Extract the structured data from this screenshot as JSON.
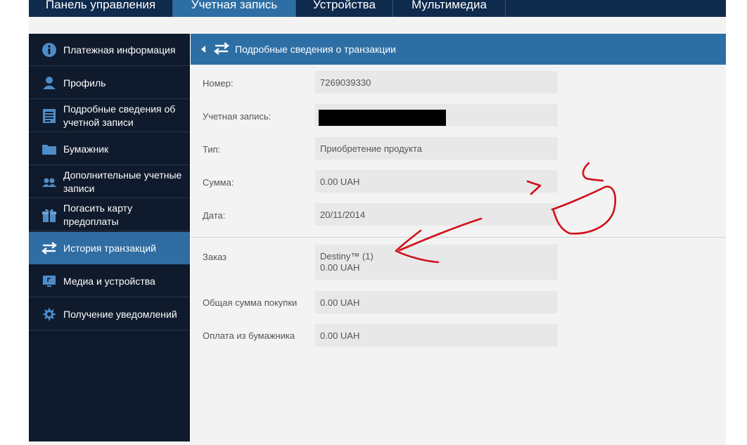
{
  "topnav": {
    "tabs": [
      {
        "label": "Панель управления"
      },
      {
        "label": "Учетная запись"
      },
      {
        "label": "Устройства"
      },
      {
        "label": "Мультимедиа"
      }
    ],
    "active_index": 1
  },
  "sidebar": {
    "items": [
      {
        "label": "Платежная информация",
        "icon": "info-icon"
      },
      {
        "label": "Профиль",
        "icon": "user-icon"
      },
      {
        "label": "Подробные сведения об учетной записи",
        "icon": "document-icon"
      },
      {
        "label": "Бумажник",
        "icon": "wallet-icon"
      },
      {
        "label": "Дополнительные учетные записи",
        "icon": "users-icon"
      },
      {
        "label": "Погасить карту предоплаты",
        "icon": "gift-icon"
      },
      {
        "label": "История транзакций",
        "icon": "swap-arrows-icon"
      },
      {
        "label": "Медиа и устройства",
        "icon": "monitor-icon"
      },
      {
        "label": "Получение уведомлений",
        "icon": "notification-icon"
      }
    ],
    "active_index": 6
  },
  "main": {
    "header_title": "Подробные сведения о транзакции",
    "fields": {
      "number": {
        "label": "Номер:",
        "value": "7269039330"
      },
      "account": {
        "label": "Учетная запись:",
        "value": ""
      },
      "type": {
        "label": "Тип:",
        "value": "Приобретение продукта"
      },
      "amount": {
        "label": "Сумма:",
        "value": "0.00 UAH"
      },
      "date": {
        "label": "Дата:",
        "value": "20/11/2014"
      },
      "order": {
        "label": "Заказ",
        "item": "Destiny™ (1)",
        "price": "0.00 UAH"
      },
      "total": {
        "label": "Общая сумма покупки",
        "value": "0.00 UAH"
      },
      "wallet": {
        "label": "Оплата из бумажника",
        "value": "0.00 UAH"
      }
    }
  },
  "colors": {
    "nav_dark": "#0e2a4d",
    "accent_blue": "#2d6fa5",
    "sidebar_bg": "#0f1a2c",
    "annotation_red": "#d0101a"
  }
}
